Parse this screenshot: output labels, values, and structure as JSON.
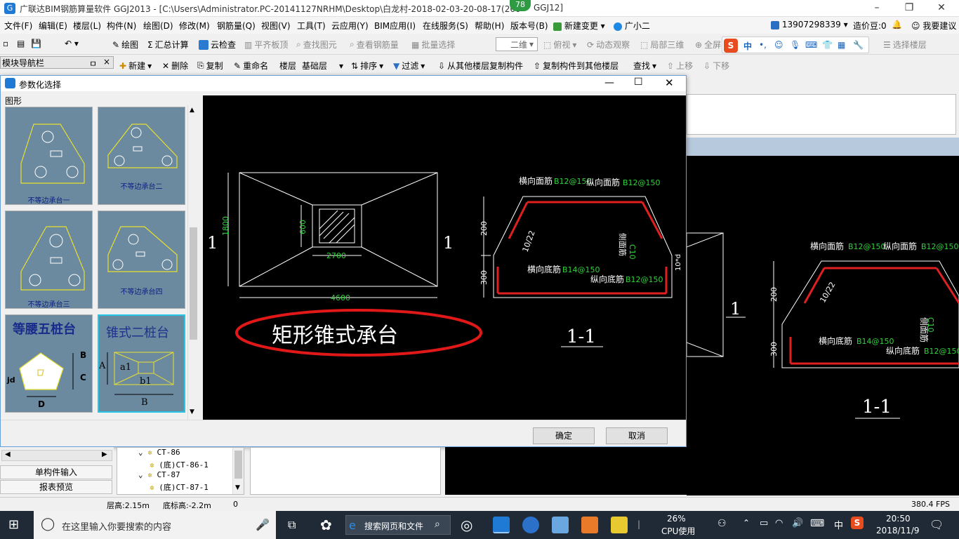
{
  "titlebar": {
    "title": "广联达BIM钢筋算量软件 GGJ2013 - [C:\\Users\\Administrator.PC-20141127NRHM\\Desktop\\白龙村-2018-02-03-20-08-17(260",
    "title_tail": "GGJ12]",
    "badge": "78",
    "minimize": "–",
    "restore": "❐",
    "close": "✕"
  },
  "menubar": {
    "items": [
      "文件(F)",
      "编辑(E)",
      "楼层(L)",
      "构件(N)",
      "绘图(D)",
      "修改(M)",
      "钢筋量(Q)",
      "视图(V)",
      "工具(T)",
      "云应用(Y)",
      "BIM应用(I)",
      "在线服务(S)",
      "帮助(H)",
      "版本号(B)"
    ],
    "new_change": "新建变更",
    "xiaoer": "广小二",
    "phone": "13907298339",
    "coins": "造价豆:0",
    "suggest": "我要建议"
  },
  "toolbar1": {
    "draw": "绘图",
    "sum": "汇总计算",
    "cloud_check": "云检查",
    "align_top": "平齐板顶",
    "find_elem": "查找图元",
    "view_rebar": "查看钢筋量",
    "batch_select": "批量选择",
    "view_mode": "二维",
    "top_view": "俯视",
    "dynamic": "动态观察",
    "local_3d": "局部三维",
    "full": "全屏",
    "select_floor": "选择楼层",
    "ime_lang": "中"
  },
  "toolbar2": {
    "new": "新建",
    "delete": "删除",
    "copy": "复制",
    "rename": "重命名",
    "floor_label": "楼层",
    "floor_value": "基础层",
    "sort": "排序",
    "filter": "过滤",
    "copy_from": "从其他楼层复制构件",
    "copy_to": "复制构件到其他楼层",
    "find": "查找",
    "up": "上移",
    "down": "下移"
  },
  "nav": {
    "header": "模块导航栏",
    "pin": "ㅁ",
    "close": "×"
  },
  "dialog": {
    "title": "参数化选择",
    "group_label": "图形",
    "ok": "确定",
    "cancel": "取消",
    "thumbs": [
      {
        "label": "不等边承台一"
      },
      {
        "label": "不等边承台二"
      },
      {
        "label": "不等边承台三"
      },
      {
        "label": "不等边承台四"
      },
      {
        "label": "等腰五桩台",
        "labels": [
          "B",
          "C",
          "D",
          "jd"
        ]
      },
      {
        "label": "锥式二桩台",
        "labels": [
          "A",
          "a1",
          "b1",
          "B"
        ]
      }
    ],
    "drawing": {
      "plan_dims": {
        "h": "1800",
        "inner_h": "600",
        "inner_w": "2700",
        "w": "4600"
      },
      "section_marks": [
        "1",
        "1"
      ],
      "caption": "矩形锥式承台",
      "section_title": "1-1",
      "rebar": {
        "top_trans": "横向面筋",
        "top_trans_val": "B12@150",
        "top_long": "纵向面筋",
        "top_long_val": "B12@150",
        "bot_trans": "横向底筋",
        "bot_trans_val": "B14@150",
        "bot_long": "纵向底筋",
        "bot_long_val": "B12@150",
        "side": "侧面筋",
        "side_val": "C10",
        "slope": "10/22",
        "h1": "200",
        "h2": "300",
        "cover": "10*d"
      }
    }
  },
  "rightcad": {
    "top_trans": "横向面筋",
    "top_trans_val": "B12@150",
    "top_long": "纵向面筋",
    "top_long_val": "B12@150",
    "bot_trans": "横向底筋",
    "bot_trans_val": "B14@150",
    "bot_long": "纵向底筋",
    "bot_long_val": "B12@150",
    "side": "侧面筋",
    "side_val": "C10",
    "slope": "10/22",
    "h1": "200",
    "h2": "300",
    "mark": "1",
    "section": "1-1"
  },
  "leftbottom": {
    "single": "单构件输入",
    "report": "报表预览"
  },
  "tree": {
    "items": [
      "CT-86",
      "(底)CT-86-1",
      "CT-87",
      "(底)CT-87-1"
    ]
  },
  "statusbar": {
    "floor_h": "层高:2.15m",
    "base_h": "底标高:-2.2m",
    "zero": "0",
    "fps": "380.4 FPS"
  },
  "taskbar": {
    "search_placeholder": "在这里输入你要搜索的内容",
    "web_search": "搜索网页和文件",
    "cpu_pct": "26%",
    "cpu_label": "CPU使用",
    "ime": "中",
    "time": "20:50",
    "date": "2018/11/9"
  }
}
